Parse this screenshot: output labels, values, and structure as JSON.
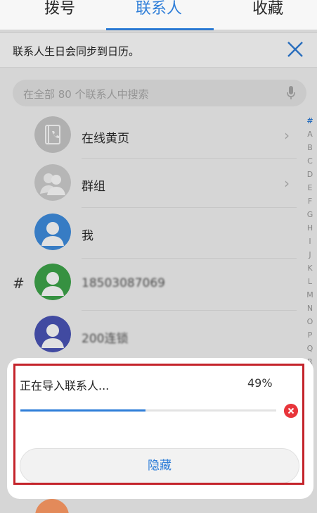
{
  "tabs": [
    {
      "label": "拨号"
    },
    {
      "label": "联系人",
      "active": true
    },
    {
      "label": "收藏"
    }
  ],
  "banner": {
    "text": "联系人生日会同步到日历。"
  },
  "search": {
    "placeholder": "在全部 80 个联系人中搜索"
  },
  "contacts": [
    {
      "label": "在线黄页",
      "icon": "yellow-pages-icon",
      "chevron": true
    },
    {
      "label": "群组",
      "icon": "group-icon",
      "chevron": true
    },
    {
      "label": "我",
      "icon": "me-avatar-icon"
    },
    {
      "label": "18503087069",
      "icon": "contact-avatar-icon"
    },
    {
      "label": "200连锁",
      "icon": "contact-avatar-icon"
    }
  ],
  "section_header": "#",
  "index_letters": [
    "#",
    "A",
    "B",
    "C",
    "D",
    "E",
    "F",
    "G",
    "H",
    "I",
    "J",
    "K",
    "L",
    "M",
    "N",
    "O",
    "P",
    "Q",
    "R"
  ],
  "dialog": {
    "title": "正在导入联系人...",
    "percent_text": "49%",
    "progress": 0.49,
    "hide_label": "隐藏"
  },
  "colors": {
    "accent": "#2f7ed8",
    "danger": "#e8353b",
    "highlight_border": "#c4242b"
  }
}
